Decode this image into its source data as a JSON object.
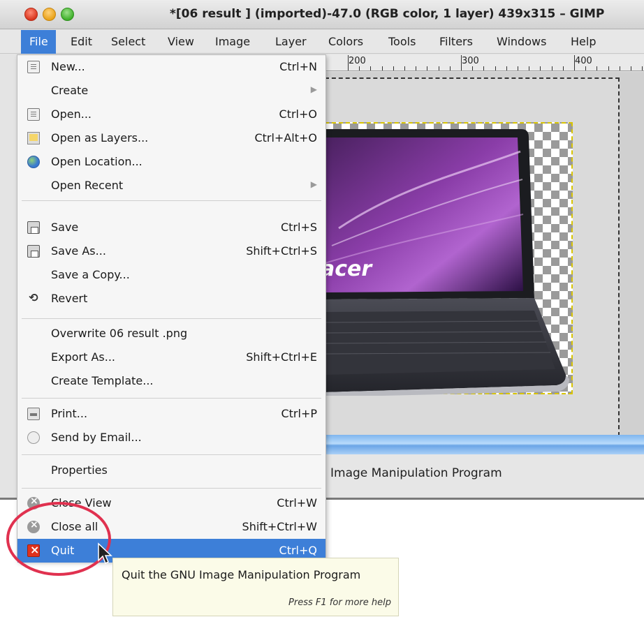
{
  "window": {
    "title": "*[06 result ] (imported)-47.0 (RGB color, 1 layer) 439x315 – GIMP"
  },
  "menubar": {
    "items": [
      "File",
      "Edit",
      "Select",
      "View",
      "Image",
      "Layer",
      "Colors",
      "Tools",
      "Filters",
      "Windows",
      "Help"
    ]
  },
  "ruler": {
    "labels": [
      "200",
      "300",
      "400"
    ]
  },
  "file_menu": {
    "items": [
      {
        "label": "New...",
        "accel": "Ctrl+N",
        "icon": "new-document-icon"
      },
      {
        "label": "Create",
        "accel": "",
        "icon": "",
        "submenu": true
      },
      {
        "label": "Open...",
        "accel": "Ctrl+O",
        "icon": "open-image-icon"
      },
      {
        "label": "Open as Layers...",
        "accel": "Ctrl+Alt+O",
        "icon": "open-layers-icon"
      },
      {
        "label": "Open Location...",
        "accel": "",
        "icon": "globe-icon"
      },
      {
        "label": "Open Recent",
        "accel": "",
        "icon": "",
        "submenu": true
      },
      {
        "label": "Save",
        "accel": "Ctrl+S",
        "icon": "save-icon"
      },
      {
        "label": "Save As...",
        "accel": "Shift+Ctrl+S",
        "icon": "save-as-icon"
      },
      {
        "label": "Save a Copy...",
        "accel": "",
        "icon": ""
      },
      {
        "label": "Revert",
        "accel": "",
        "icon": "revert-icon"
      },
      {
        "label": "Overwrite 06 result .png",
        "accel": "",
        "icon": ""
      },
      {
        "label": "Export As...",
        "accel": "Shift+Ctrl+E",
        "icon": ""
      },
      {
        "label": "Create Template...",
        "accel": "",
        "icon": ""
      },
      {
        "label": "Print...",
        "accel": "Ctrl+P",
        "icon": "print-icon"
      },
      {
        "label": "Send by Email...",
        "accel": "",
        "icon": "email-icon"
      },
      {
        "label": "Properties",
        "accel": "",
        "icon": ""
      },
      {
        "label": "Close View",
        "accel": "Ctrl+W",
        "icon": "close-view-icon"
      },
      {
        "label": "Close all",
        "accel": "Shift+Ctrl+W",
        "icon": "close-all-icon"
      },
      {
        "label": "Quit",
        "accel": "Ctrl+Q",
        "icon": "quit-icon"
      }
    ]
  },
  "image": {
    "brand": "acer"
  },
  "status": {
    "text": "Image Manipulation Program"
  },
  "tooltip": {
    "main": "Quit the GNU Image Manipulation Program",
    "help": "Press F1 for more help"
  },
  "colors": {
    "highlight": "#3d7fd8",
    "annotation": "#e0314f"
  }
}
